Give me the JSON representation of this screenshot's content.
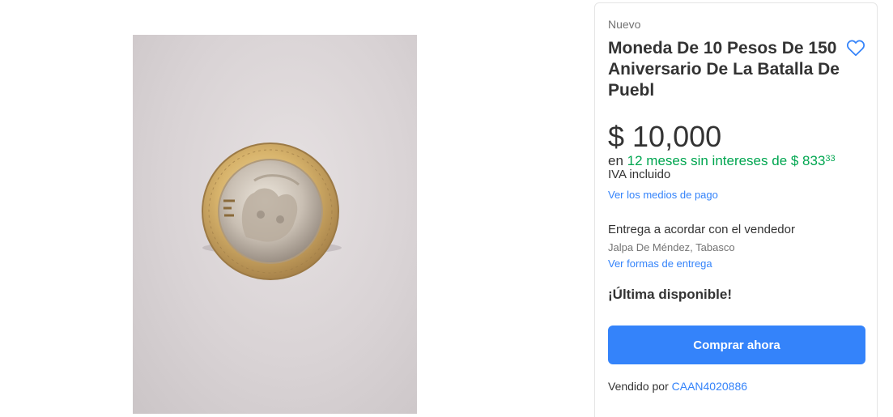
{
  "gallery": {
    "image_alt": "coin-photo"
  },
  "product": {
    "condition": "Nuevo",
    "title": "Moneda De 10 Pesos De 150 Aniversario De La Batalla De Puebl",
    "price": "$ 10,000",
    "installments_prefix": "en",
    "installments_text": "12 meses sin intereses de $ 833",
    "installments_cents": "33",
    "iva": "IVA incluido",
    "payment_link": "Ver los medios de pago"
  },
  "shipping": {
    "delivery": "Entrega a acordar con el vendedor",
    "location": "Jalpa De Méndez, Tabasco",
    "delivery_link": "Ver formas de entrega"
  },
  "stock": {
    "label": "¡Última disponible!"
  },
  "actions": {
    "buy_label": "Comprar ahora"
  },
  "seller": {
    "prefix": "Vendido por",
    "name": "CAAN4020886"
  },
  "colors": {
    "accent": "#3483fa",
    "installments_green": "#00a650"
  },
  "icons": {
    "favorite": "heart-outline-icon"
  }
}
